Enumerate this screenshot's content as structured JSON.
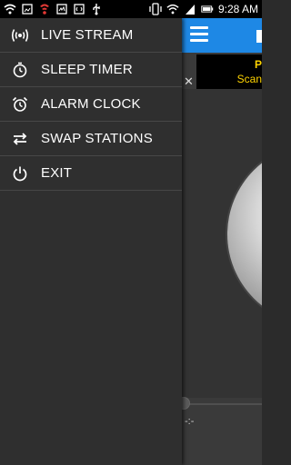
{
  "status_bar": {
    "time": "9:28 AM",
    "icons": [
      "wifi-icon",
      "gallery-icon",
      "bug-icon",
      "image-icon",
      "code-icon",
      "usb-icon",
      "vibrate-icon",
      "wifi-signal-icon",
      "signal-icon",
      "battery-icon"
    ]
  },
  "drawer": {
    "items": [
      {
        "label": "LIVE STREAM",
        "icon": "broadcast-icon"
      },
      {
        "label": "SLEEP TIMER",
        "icon": "timer-icon"
      },
      {
        "label": "ALARM CLOCK",
        "icon": "alarm-icon"
      },
      {
        "label": "SWAP STATIONS",
        "icon": "swap-icon"
      },
      {
        "label": "EXIT",
        "icon": "power-icon"
      }
    ]
  },
  "app": {
    "ad": {
      "line1": "P",
      "line2": "Scan",
      "close": "✕"
    },
    "player": {
      "time": "-:-"
    }
  },
  "colors": {
    "header": "#1e88e5",
    "drawer": "#2f2f2f",
    "ad_text": "#ffd400"
  }
}
